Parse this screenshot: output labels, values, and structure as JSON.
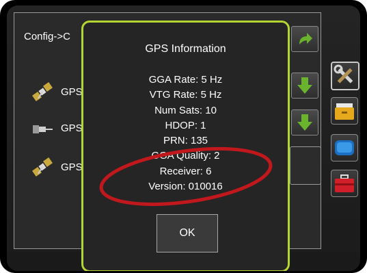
{
  "config_panel": {
    "title": "Config->C",
    "rows": [
      {
        "label": "GPS",
        "icon": "satellite-icon"
      },
      {
        "label": "GPS",
        "icon": "antenna-icon"
      },
      {
        "label": "GPS",
        "icon": "satellite-icon"
      }
    ]
  },
  "dialog": {
    "title": "GPS Information",
    "lines": [
      "GGA Rate: 5 Hz",
      "VTG Rate: 5 Hz",
      "Num Sats: 10",
      "HDOP: 1",
      "PRN: 135",
      "GGA Quality: 2",
      "Receiver: 6",
      "Version: 010016"
    ],
    "ok_label": "OK"
  },
  "side_buttons": [
    {
      "icon": "tools-icon",
      "active": true
    },
    {
      "icon": "folder-icon",
      "active": false
    },
    {
      "icon": "display-icon",
      "active": false
    },
    {
      "icon": "toolbox-icon",
      "active": false
    }
  ],
  "colors": {
    "dialog_border": "#b5d631",
    "annotation": "#c0181c",
    "arrow_green": "#6ab42d"
  }
}
